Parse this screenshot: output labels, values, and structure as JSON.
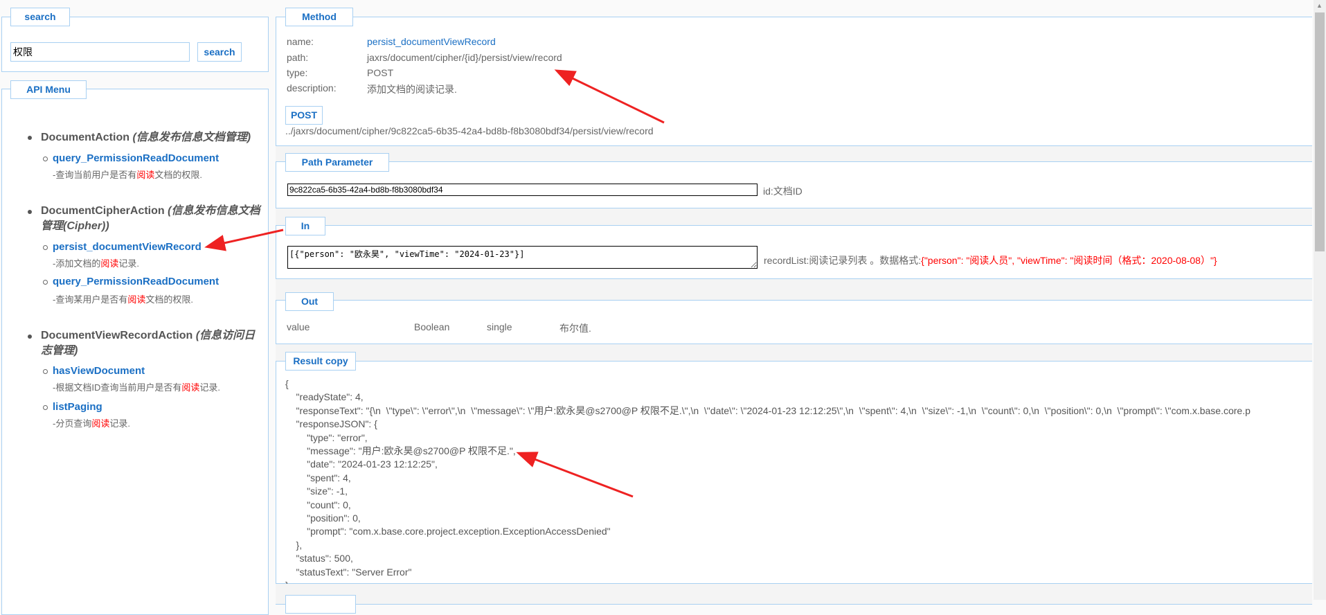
{
  "search": {
    "legend": "search",
    "input_value": "权限",
    "button": "search"
  },
  "menu": {
    "legend": "API Menu",
    "groups": [
      {
        "name": "DocumentAction",
        "desc": "(信息发布信息文档管理)",
        "items": [
          {
            "name": "query_PermissionReadDocument",
            "pre": "-查询当前用户是否有",
            "hl": "阅读",
            "post": "文档的权限."
          }
        ]
      },
      {
        "name": "DocumentCipherAction",
        "desc": "(信息发布信息文档管理(Cipher))",
        "items": [
          {
            "name": "persist_documentViewRecord",
            "pre": "-添加文档的",
            "hl": "阅读",
            "post": "记录."
          },
          {
            "name": "query_PermissionReadDocument",
            "pre": "-查询某用户是否有",
            "hl": "阅读",
            "post": "文档的权限."
          }
        ]
      },
      {
        "name": "DocumentViewRecordAction",
        "desc": "(信息访问日志管理)",
        "items": [
          {
            "name": "hasViewDocument",
            "pre": "-根据文档ID查询当前用户是否有",
            "hl": "阅读",
            "post": "记录."
          },
          {
            "name": "listPaging",
            "pre": "-分页查询",
            "hl": "阅读",
            "post": "记录."
          }
        ]
      }
    ]
  },
  "method": {
    "legend": "Method",
    "name_label": "name:",
    "name": "persist_documentViewRecord",
    "path_label": "path:",
    "path": "jaxrs/document/cipher/{id}/persist/view/record",
    "type_label": "type:",
    "type": "POST",
    "desc_label": "description:",
    "desc": "添加文档的阅读记录.",
    "button": "POST",
    "url": "../jaxrs/document/cipher/9c822ca5-6b35-42a4-bd8b-f8b3080bdf34/persist/view/record"
  },
  "path_param": {
    "legend": "Path Parameter",
    "value": "9c822ca5-6b35-42a4-bd8b-f8b3080bdf34",
    "label": "id:文档ID"
  },
  "in": {
    "legend": "In",
    "value": "[{\"person\": \"欧永昊\", \"viewTime\": \"2024-01-23\"}]",
    "label": "recordList:阅读记录列表 。数据格式:",
    "format": "{\"person\": \"阅读人员\", \"viewTime\": \"阅读时间（格式：2020-08-08）\"}"
  },
  "out": {
    "legend": "Out",
    "name": "value",
    "type": "Boolean",
    "mode": "single",
    "desc": "布尔值."
  },
  "result": {
    "legend": "Result copy",
    "lines": [
      "{",
      "    \"readyState\": 4,",
      "    \"responseText\": \"{\\n  \\\"type\\\": \\\"error\\\",\\n  \\\"message\\\": \\\"用户:欧永昊@s2700@P 权限不足.\\\",\\n  \\\"date\\\": \\\"2024-01-23 12:12:25\\\",\\n  \\\"spent\\\": 4,\\n  \\\"size\\\": -1,\\n  \\\"count\\\": 0,\\n  \\\"position\\\": 0,\\n  \\\"prompt\\\": \\\"com.x.base.core.p",
      "    \"responseJSON\": {",
      "        \"type\": \"error\",",
      "        \"message\": \"用户:欧永昊@s2700@P 权限不足.\",",
      "        \"date\": \"2024-01-23 12:12:25\",",
      "        \"spent\": 4,",
      "        \"size\": -1,",
      "        \"count\": 0,",
      "        \"position\": 0,",
      "        \"prompt\": \"com.x.base.core.project.exception.ExceptionAccessDenied\"",
      "    },",
      "    \"status\": 500,",
      "    \"statusText\": \"Server Error\"",
      "}"
    ]
  },
  "colors": {
    "accent": "#1a6fc4",
    "border": "#a8d0f2",
    "highlight": "#ff0000",
    "arrow": "#ee2222"
  }
}
